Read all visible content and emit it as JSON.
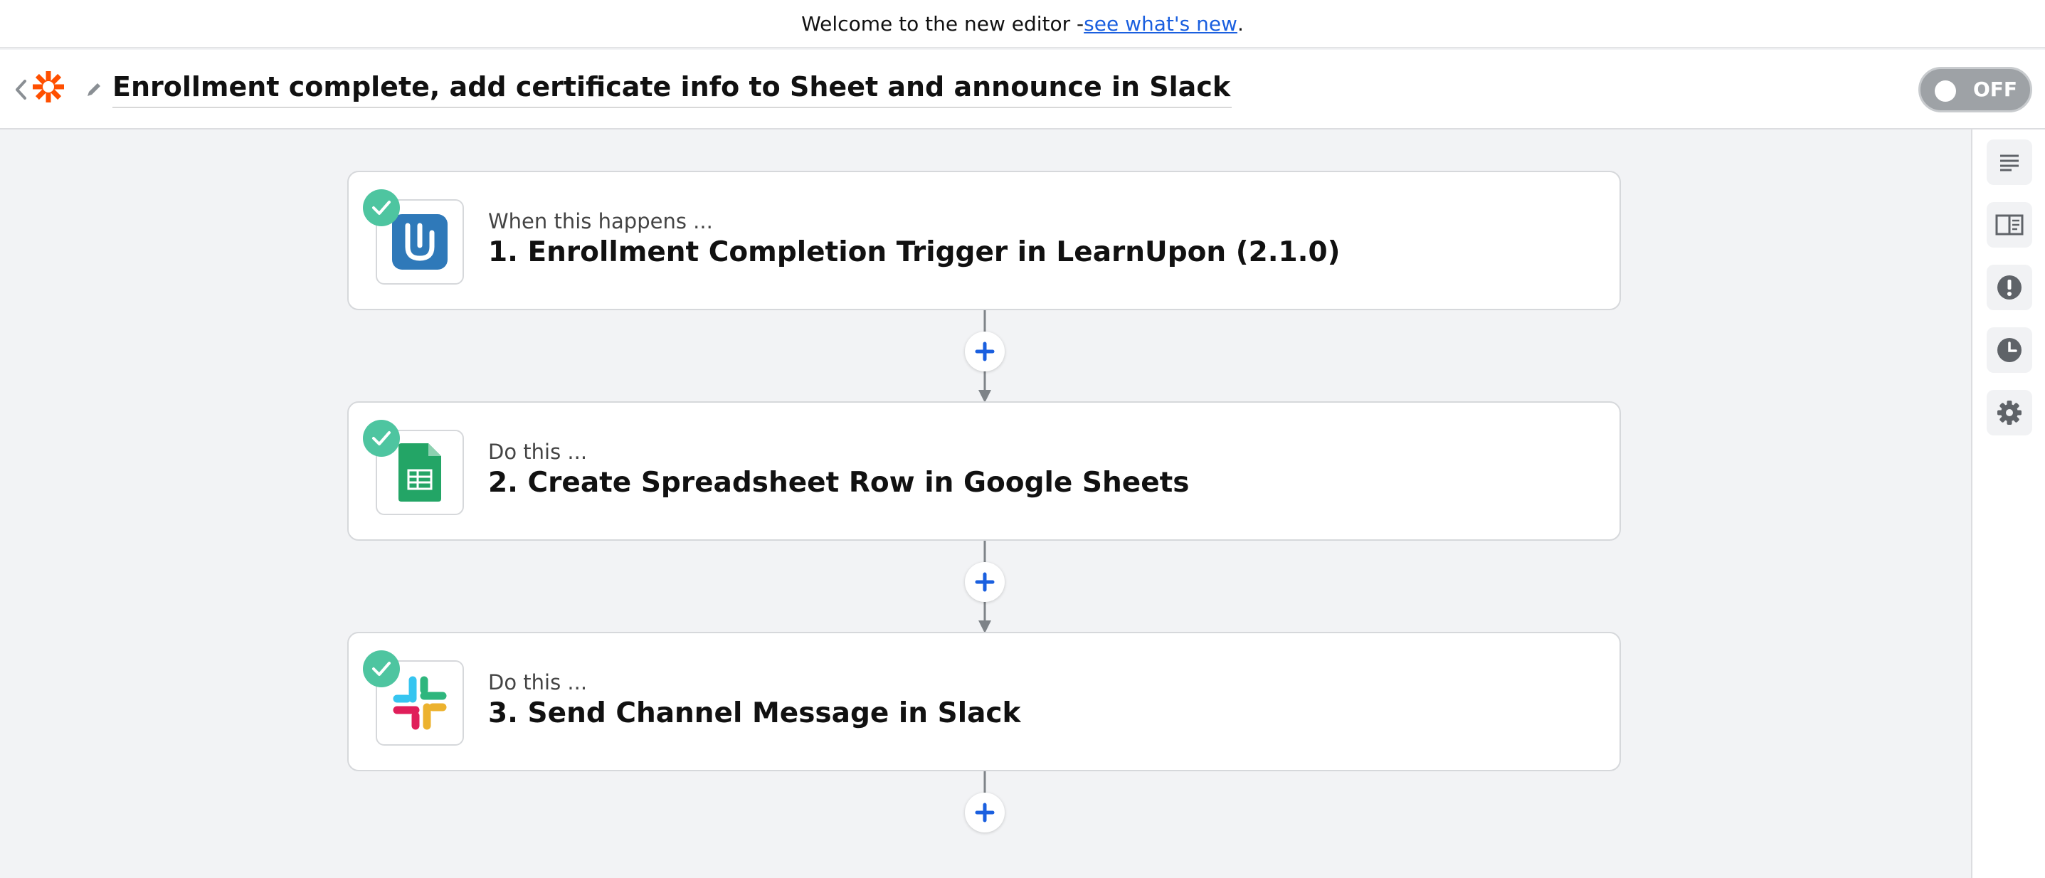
{
  "banner": {
    "text": "Welcome to the new editor - ",
    "link": "see what's new",
    "suffix": "."
  },
  "header": {
    "title": "Enrollment complete, add certificate info to Sheet and announce in Slack",
    "toggle_label": "OFF"
  },
  "steps": [
    {
      "label": "When this happens ...",
      "title": "1. Enrollment Completion Trigger in LearnUpon (2.1.0)",
      "app": "learnupon-icon"
    },
    {
      "label": "Do this ...",
      "title": "2. Create Spreadsheet Row in Google Sheets",
      "app": "google-sheets-icon"
    },
    {
      "label": "Do this ...",
      "title": "3. Send Channel Message in Slack",
      "app": "slack-icon"
    }
  ],
  "colors": {
    "accent": "#1a5fdf",
    "zapier_orange": "#ff4f00",
    "check_green": "#4ec5a0",
    "toggle_off": "#9ea2a6"
  },
  "rail": [
    "details-icon",
    "guide-icon",
    "alert-icon",
    "history-icon",
    "settings-icon"
  ]
}
